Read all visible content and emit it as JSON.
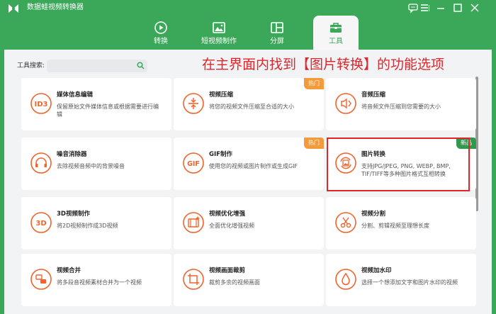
{
  "app": {
    "title": "数据蛙视频转换器"
  },
  "nav": {
    "tabs": [
      {
        "label": "转换",
        "icon": "convert-icon"
      },
      {
        "label": "短视频制作",
        "icon": "mv-icon"
      },
      {
        "label": "分屏",
        "icon": "split-screen-icon"
      },
      {
        "label": "工具",
        "icon": "toolbox-icon",
        "active": true
      }
    ]
  },
  "tools": {
    "search_label": "工具搜索:",
    "search_placeholder": "",
    "banner": "在主界面内找到【图片转换】的功能选项",
    "cards": [
      {
        "title": "媒体信息编辑",
        "desc": "保留原始文件媒体信息或根据需要进行编辑",
        "icon": "id3-icon"
      },
      {
        "title": "视频压缩",
        "desc": "将您的视频文件压缩至合适的大小",
        "icon": "compress-icon",
        "badge": "热门"
      },
      {
        "title": "音频压缩",
        "desc": "将音频文件压缩到您需要的大小",
        "icon": "audio-compress-icon"
      },
      {
        "title": "噪音消除器",
        "desc": "去除视频音频中的背景噪音",
        "icon": "headphones-icon"
      },
      {
        "title": "GIF制作",
        "desc": "使用您的视频或图片制作或生成GIF",
        "icon": "gif-icon",
        "badge": "热门"
      },
      {
        "title": "图片转换",
        "desc": "支持JPG/JPEG, PNG, WEBP, BMP, TIF/TIFF等多种图片格式互相转换",
        "icon": "image-convert-icon",
        "badge": "新品"
      },
      {
        "title": "3D视频制作",
        "desc": "将2D视频制作成3D视频",
        "icon": "3d-icon"
      },
      {
        "title": "视频优化增强",
        "desc": "全面优化增强视频",
        "icon": "enhance-icon"
      },
      {
        "title": "视频分割",
        "desc": "分割、剪辑视频至理想长度",
        "icon": "scissors-icon"
      },
      {
        "title": "视频合并",
        "desc": "将多段音视频素材合并为一个视频",
        "icon": "merge-icon"
      },
      {
        "title": "视频画面裁剪",
        "desc": "裁剪多余的视频画面",
        "icon": "crop-icon"
      },
      {
        "title": "视频加水印",
        "desc": "选择一个想添加文字和图片水印的视频",
        "icon": "watermark-icon"
      }
    ]
  },
  "colors": {
    "brand": "#3aa858",
    "accent": "#f2622b",
    "hot_badge": "#f39a3a",
    "new_badge": "#2f9a4e",
    "annotation": "#e0262b"
  }
}
